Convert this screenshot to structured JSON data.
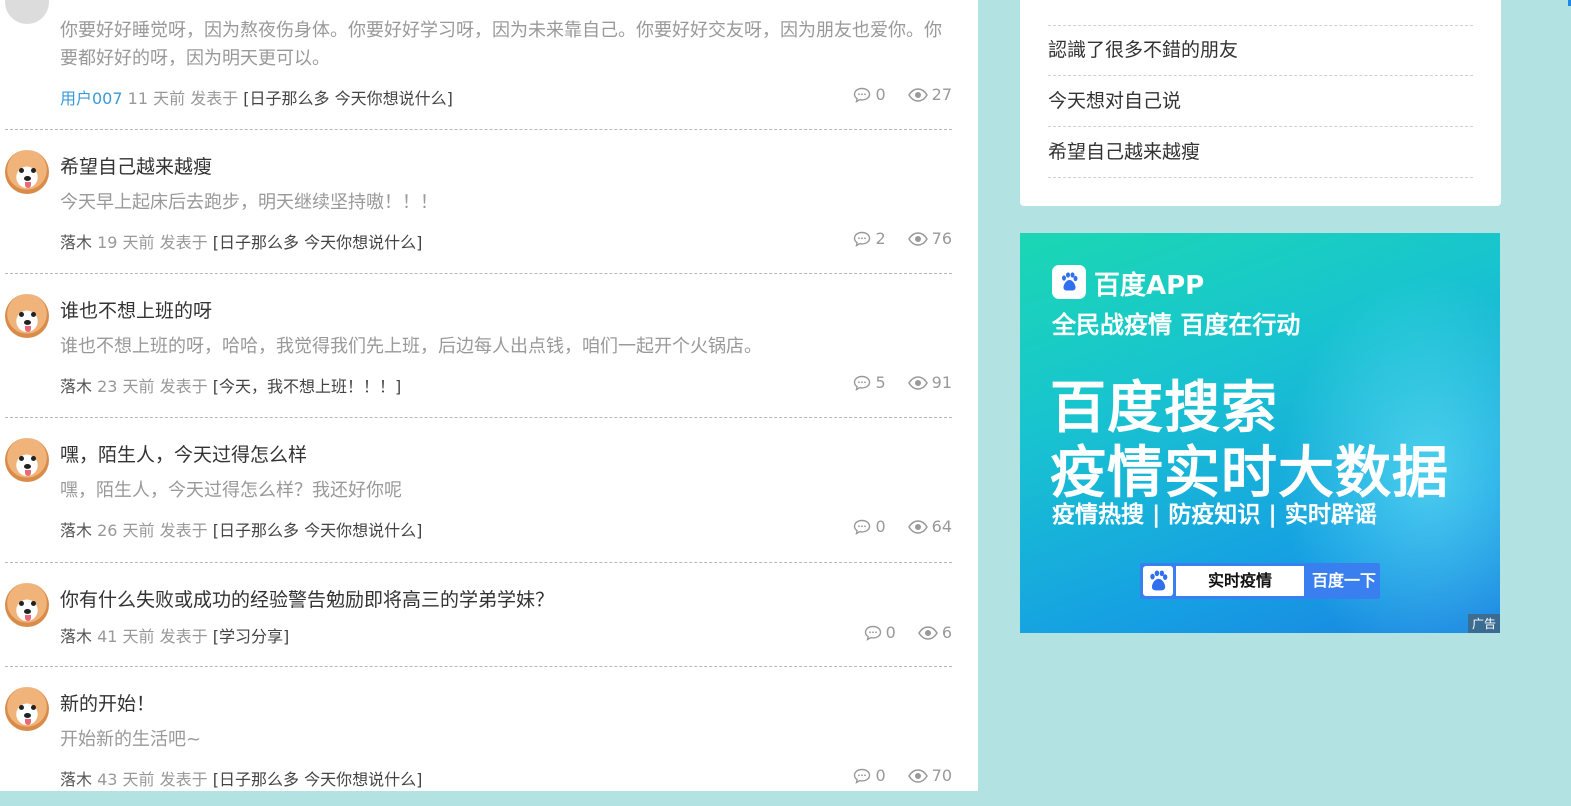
{
  "posts": [
    {
      "title": "",
      "excerpt": "你要好好睡觉呀，因为熬夜伤身体。你要好好学习呀，因为未来靠自己。你要好好交友呀，因为朋友也爱你。你要都好好的呀，因为明天更可以。",
      "author": "用户007",
      "time": "11 天前",
      "posted_in": "发表于",
      "category": "[日子那么多 今天你想说什么]",
      "comments": "0",
      "views": "27"
    },
    {
      "title": "希望自己越来越瘦",
      "excerpt": "今天早上起床后去跑步，明天继续坚持嗷！！！",
      "author": "落木",
      "time": "19 天前",
      "posted_in": "发表于",
      "category": "[日子那么多 今天你想说什么]",
      "comments": "2",
      "views": "76"
    },
    {
      "title": "谁也不想上班的呀",
      "excerpt": "谁也不想上班的呀，哈哈，我觉得我们先上班，后边每人出点钱，咱们一起开个火锅店。",
      "author": "落木",
      "time": "23 天前",
      "posted_in": "发表于",
      "category": "[今天，我不想上班！！！]",
      "comments": "5",
      "views": "91"
    },
    {
      "title": "嘿，陌生人，今天过得怎么样",
      "excerpt": "嘿，陌生人，今天过得怎么样？我还好你呢",
      "author": "落木",
      "time": "26 天前",
      "posted_in": "发表于",
      "category": "[日子那么多 今天你想说什么]",
      "comments": "0",
      "views": "64"
    },
    {
      "title": "你有什么失败或成功的经验警告勉励即将高三的学弟学妹？",
      "excerpt": "",
      "author": "落木",
      "time": "41 天前",
      "posted_in": "发表于",
      "category": "[学习分享]",
      "comments": "0",
      "views": "6"
    },
    {
      "title": "新的开始！",
      "excerpt": "开始新的生活吧~",
      "author": "落木",
      "time": "43 天前",
      "posted_in": "发表于",
      "category": "[日子那么多 今天你想说什么]",
      "comments": "0",
      "views": "70"
    }
  ],
  "sidebar": {
    "items": [
      "認識了很多不錯的朋友",
      "今天想对自己说",
      "希望自己越来越瘦"
    ]
  },
  "ad": {
    "app_name": "百度APP",
    "slogan": "全民战疫情 百度在行动",
    "headline_1": "百度搜索",
    "headline_2": "疫情实时大数据",
    "tags": "疫情热搜 | 防疫知识 | 实时辟谣",
    "search_text": "实时疫情",
    "search_button": "百度一下",
    "ad_label": "广告"
  },
  "colors": {
    "page_background": "#b3e2e2",
    "link": "#3a9ad9"
  }
}
